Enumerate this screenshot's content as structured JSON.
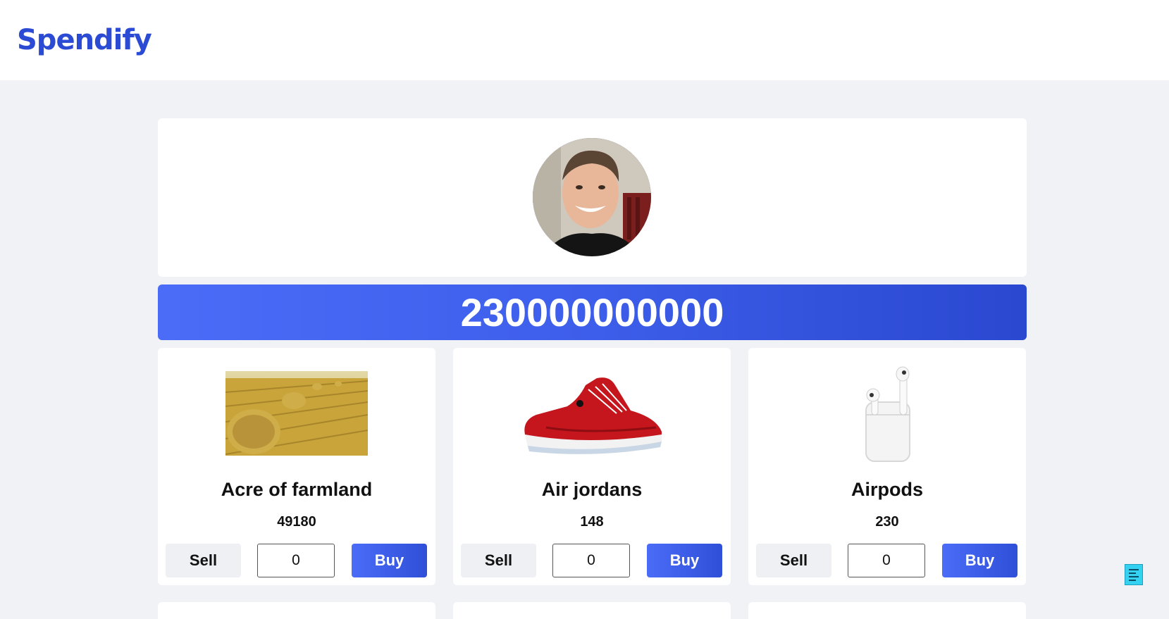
{
  "header": {
    "logo": "Spendify"
  },
  "profile": {
    "avatar_alt": "profile-photo"
  },
  "balance": "230000000000",
  "items": [
    {
      "name": "Acre of farmland",
      "price": "49180",
      "sell_label": "Sell",
      "quantity": "0",
      "buy_label": "Buy",
      "image": "hay-field-image"
    },
    {
      "name": "Air jordans",
      "price": "148",
      "sell_label": "Sell",
      "quantity": "0",
      "buy_label": "Buy",
      "image": "red-sneaker-image"
    },
    {
      "name": "Airpods",
      "price": "230",
      "sell_label": "Sell",
      "quantity": "0",
      "buy_label": "Buy",
      "image": "airpods-image"
    }
  ],
  "colors": {
    "brand": "#2b4bd4",
    "balance_start": "#4a6cf7",
    "balance_end": "#2a48d0",
    "page_bg": "#f0f2f5"
  }
}
